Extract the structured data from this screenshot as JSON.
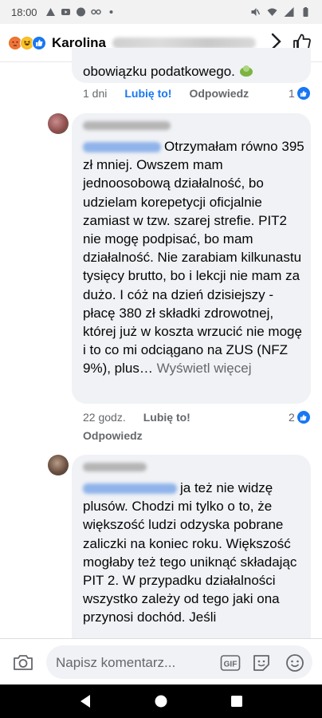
{
  "status_bar": {
    "time": "18:00"
  },
  "header": {
    "name": "Karolina",
    "reactions": [
      "angry-reaction",
      "haha-reaction",
      "like-reaction"
    ]
  },
  "prev_comment": {
    "tail_text": "obowiązku podatkowego.",
    "time": "1 dni",
    "like_label": "Lubię to!",
    "reply_label": "Odpowiedz",
    "like_count": "1"
  },
  "comment1": {
    "body": "Otrzymałam równo 395 zł mniej. Owszem mam jednoosobową działalność, bo udzielam korepetycji oficjalnie zamiast w tzw. szarej strefie. PIT2 nie mogę podpisać, bo mam działalność. Nie zarabiam kilkunastu tysięcy brutto, bo i lekcji nie mam za dużo. I cóż na dzień dzisiejszy - płacę 380 zł składki zdrowotnej, której już w koszta wrzucić nie mogę i to co mi odciągano na ZUS (NFZ 9%), plus…",
    "see_more": "Wyświetl więcej",
    "time": "22 godz.",
    "like_label": "Lubię to!",
    "reply_label": "Odpowiedz",
    "like_count": "2"
  },
  "comment2": {
    "body": "ja też nie widzę plusów. Chodzi mi tylko o to, że większość ludzi odzyska pobrane zaliczki na koniec roku. Większość mogłaby też tego uniknąć składając PIT 2. W przypadku działalności wszystko zależy od tego jaki ona przynosi dochód. Jeśli"
  },
  "composer": {
    "placeholder": "Napisz komentarz..."
  },
  "colors": {
    "accent": "#1877f2",
    "bubble": "#f0f2f5",
    "muted": "#65676b"
  }
}
